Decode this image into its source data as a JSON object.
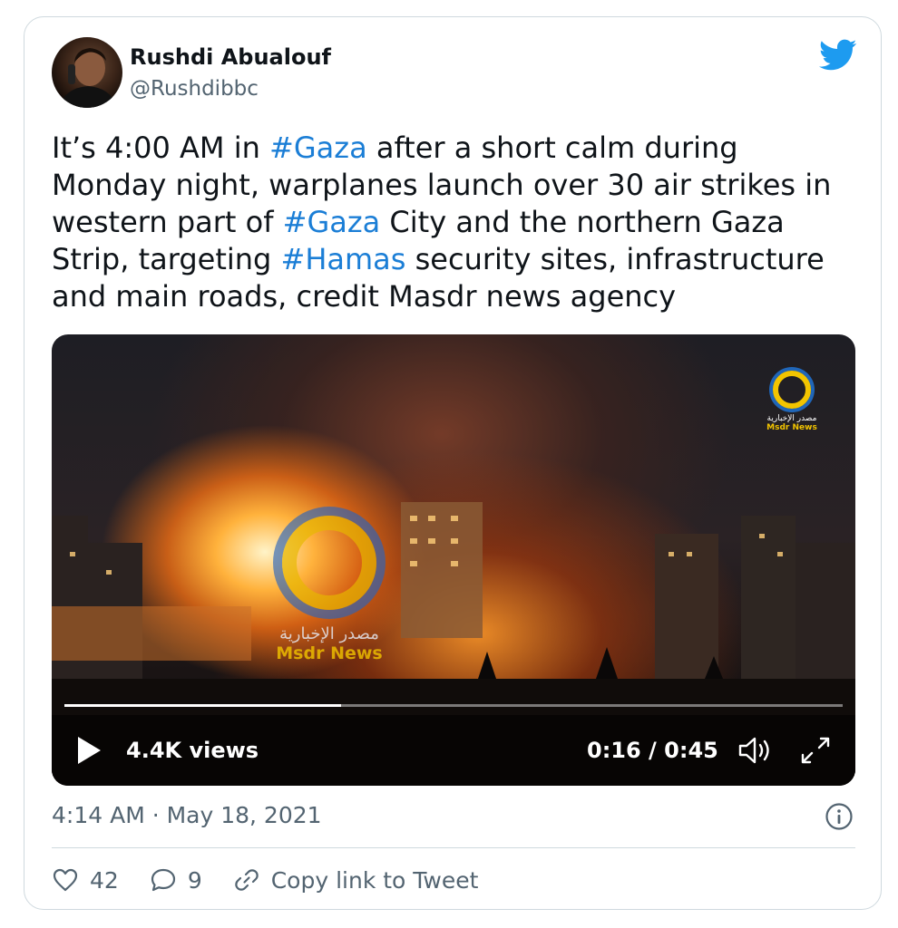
{
  "author": {
    "name": "Rushdi Abualouf",
    "handle": "@Rushdibbc"
  },
  "tweet": {
    "text_parts": [
      "It’s 4:00 AM in ",
      "#Gaza",
      " after a short calm during Monday night, warplanes launch over 30 air strikes in western part of ",
      "#Gaza",
      " City and the northern Gaza Strip, targeting ",
      "#Hamas",
      " security sites, infrastructure and main roads, credit Masdr news agency"
    ],
    "timestamp": "4:14 AM · May 18, 2021"
  },
  "video": {
    "views": "4.4K views",
    "time": "0:16 / 0:45",
    "progress_fraction": 0.356,
    "watermark_arabic": "مصدر الإخبارية",
    "watermark_english": "Msdr News"
  },
  "actions": {
    "likes": "42",
    "replies": "9",
    "copy_link": "Copy link to Tweet"
  },
  "colors": {
    "hashtag": "#1b7ed6",
    "twitter_blue": "#1d9bf0",
    "muted": "#536471"
  },
  "icons": [
    "twitter-bird-icon",
    "play-icon",
    "volume-icon",
    "fullscreen-icon",
    "info-icon",
    "heart-icon",
    "reply-icon",
    "link-icon"
  ]
}
